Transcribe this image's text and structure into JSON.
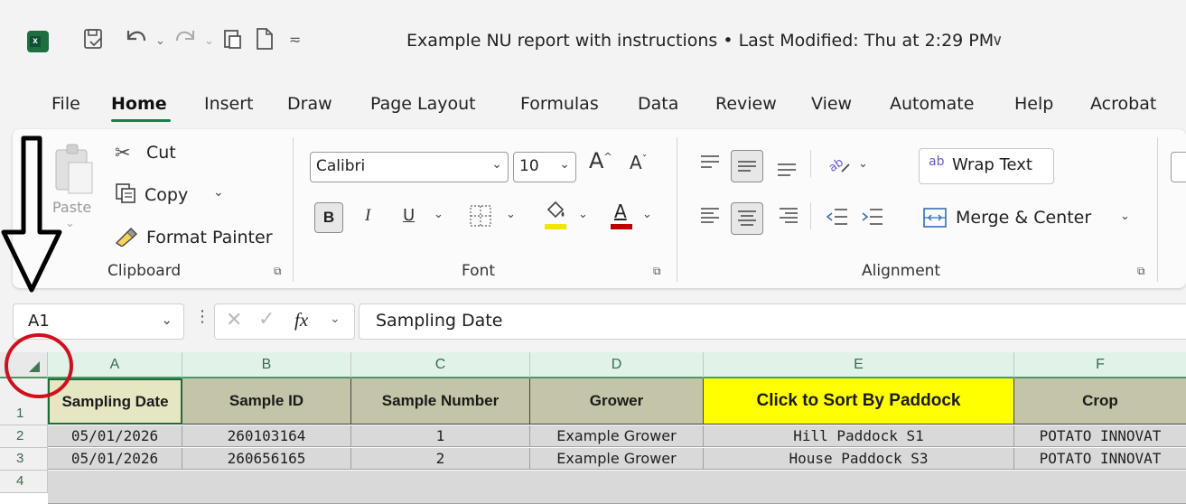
{
  "title_bar": {
    "title": "Example NU report with instructions • Last Modified: Thu at 2:29 PM",
    "title_chevron": "∨"
  },
  "menu": {
    "items": [
      "File",
      "Home",
      "Insert",
      "Draw",
      "Page Layout",
      "Formulas",
      "Data",
      "Review",
      "View",
      "Automate",
      "Help",
      "Acrobat"
    ],
    "active": "Home",
    "accent_color": "#1a7f4b"
  },
  "clipboard": {
    "paste_label": "Paste",
    "cut_label": "Cut",
    "copy_label": "Copy",
    "format_painter_label": "Format Painter",
    "group_label": "Clipboard"
  },
  "font": {
    "font_name": "Calibri",
    "font_size": "10",
    "bold": "B",
    "italic": "I",
    "underline": "U",
    "font_color_letter": "A",
    "grow_letter": "A",
    "shrink_letter": "A",
    "group_label": "Font",
    "highlight_color": "#f2e600",
    "font_color": "#c00000"
  },
  "alignment": {
    "wrap_text_label": "Wrap Text",
    "wrap_icon_text": "ab",
    "merge_label": "Merge & Center",
    "group_label": "Alignment"
  },
  "formula_bar": {
    "name_box": "A1",
    "fx_label": "fx",
    "formula": "Sampling Date"
  },
  "sheet": {
    "columns": [
      "A",
      "B",
      "C",
      "D",
      "E",
      "F"
    ],
    "row_numbers": [
      "1",
      "2",
      "3",
      "4"
    ],
    "header_row": [
      "Sampling Date",
      "Sample ID",
      "Sample Number",
      "Grower",
      "Click to Sort By Paddock",
      "Crop"
    ],
    "rows": [
      [
        "05/01/2026",
        "260103164",
        "1",
        "Example Grower",
        "Hill Paddock S1",
        "POTATO INNOVAT"
      ],
      [
        "05/01/2026",
        "260656165",
        "2",
        "Example Grower",
        "House Paddock S3",
        "POTATO INNOVAT"
      ]
    ],
    "header_fill": "#c4c4a8",
    "first_header_fill": "#e6e6c2",
    "highlight_header_fill": "#ffff00",
    "data_fill": "#d9d9d9"
  },
  "annotations": {
    "arrow_color": "#000000",
    "circle_color": "#d0101e"
  }
}
